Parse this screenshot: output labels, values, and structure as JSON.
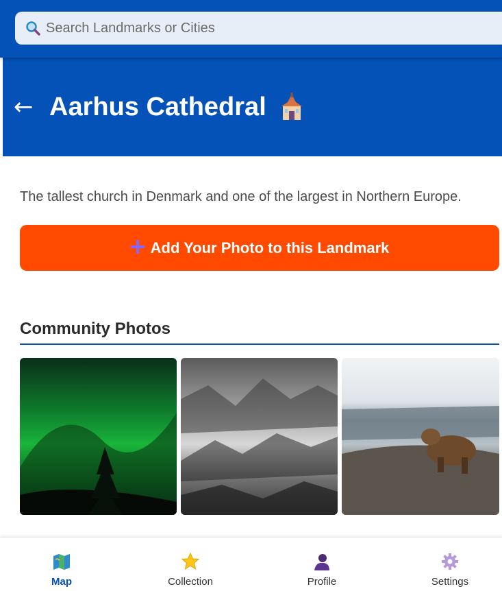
{
  "search": {
    "placeholder": "Search Landmarks or Cities",
    "icon": "search-icon"
  },
  "header": {
    "back_label": "←",
    "title": "Aarhus Cathedral",
    "emoji_icon": "church-icon"
  },
  "landmark": {
    "description": "The tallest church in Denmark and one of the largest in Northern Europe."
  },
  "add_photo_button": {
    "icon": "plus-icon",
    "label": "Add Your Photo to this Landmark"
  },
  "community_photos": {
    "title": "Community Photos",
    "photos": [
      {
        "subject": "aurora-borealis-photo"
      },
      {
        "subject": "misty-forest-photo"
      },
      {
        "subject": "bear-photo"
      }
    ]
  },
  "nav": {
    "items": [
      {
        "label": "Map",
        "icon": "map-icon",
        "active": true
      },
      {
        "label": "Collection",
        "icon": "star-icon",
        "active": false
      },
      {
        "label": "Profile",
        "icon": "profile-icon",
        "active": false
      },
      {
        "label": "Settings",
        "icon": "gear-icon",
        "active": false
      }
    ]
  },
  "colors": {
    "primary": "#0452b7",
    "accent": "#ff4a00",
    "plus": "#8a64ff"
  }
}
